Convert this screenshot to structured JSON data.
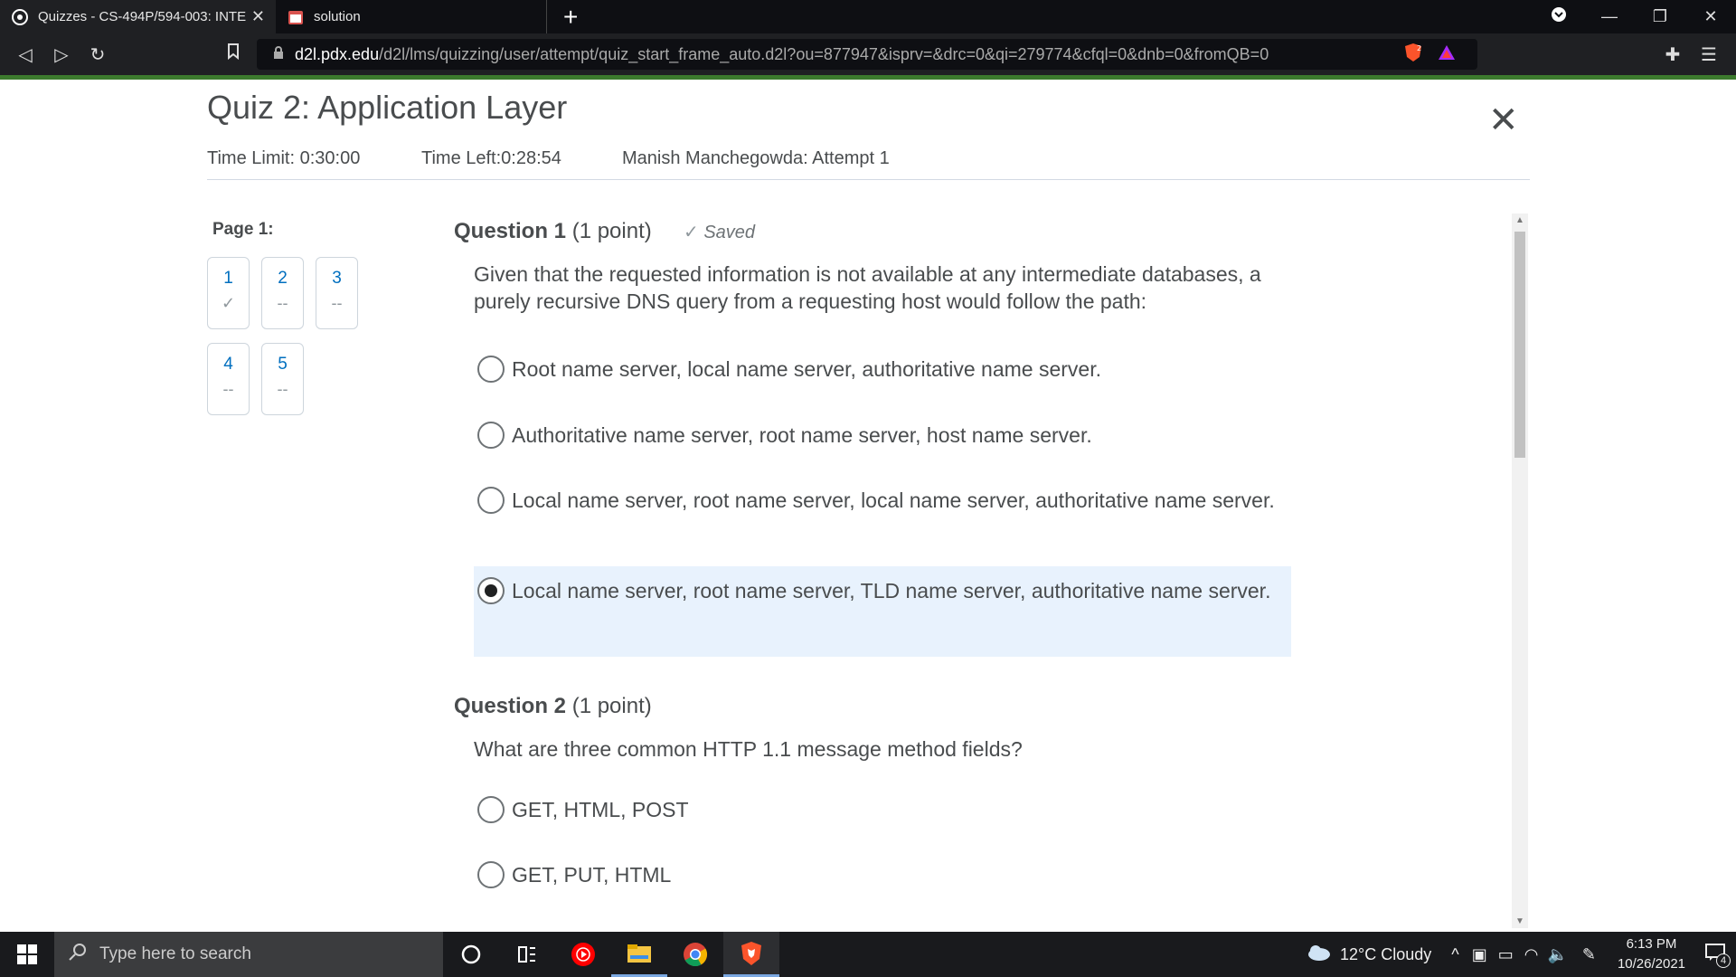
{
  "browser": {
    "tabs": [
      {
        "title": "Quizzes - CS-494P/594-003: INTE",
        "active": true
      },
      {
        "title": "solution",
        "active": false
      }
    ],
    "new_tab": "+",
    "url_host": "d2l.pdx.edu",
    "url_path": "/d2l/lms/quizzing/user/attempt/quiz_start_frame_auto.d2l?ou=877947&isprv=&drc=0&qi=279774&cfql=0&dnb=0&fromQB=0",
    "shield_count": "2"
  },
  "quiz": {
    "title": "Quiz 2: Application Layer",
    "time_limit": "Time Limit: 0:30:00",
    "time_left": "Time Left:0:28:54",
    "attempt": "Manish Manchegowda: Attempt 1",
    "page_label": "Page 1:",
    "nav": [
      {
        "num": "1",
        "status": "✓"
      },
      {
        "num": "2",
        "status": "--"
      },
      {
        "num": "3",
        "status": "--"
      },
      {
        "num": "4",
        "status": "--"
      },
      {
        "num": "5",
        "status": "--"
      }
    ],
    "questions": [
      {
        "label": "Question 1",
        "points": "(1 point)",
        "saved": "Saved",
        "text": "Given that the requested information is not available at any intermediate databases, a purely recursive DNS query from a requesting host would follow the path:",
        "options": [
          "Root name server, local name server, authoritative name server.",
          "Authoritative name server, root name server, host name server.",
          "Local name server, root name server, local name server, authoritative name server.",
          "Local name server, root name server, TLD name server, authoritative name server."
        ],
        "selected_index": 3
      },
      {
        "label": "Question 2",
        "points": "(1 point)",
        "text": "What are three common HTTP 1.1 message method fields?",
        "options": [
          "GET, HTML, POST",
          "GET, PUT, HTML"
        ]
      }
    ]
  },
  "taskbar": {
    "search_placeholder": "Type here to search",
    "weather": "12°C  Cloudy",
    "time": "6:13 PM",
    "date": "10/26/2021",
    "notifications": "4"
  },
  "colors": {
    "accent_green": "#3c7a2d",
    "link_blue": "#006fbf",
    "selected_bg": "#e8f2fd"
  }
}
